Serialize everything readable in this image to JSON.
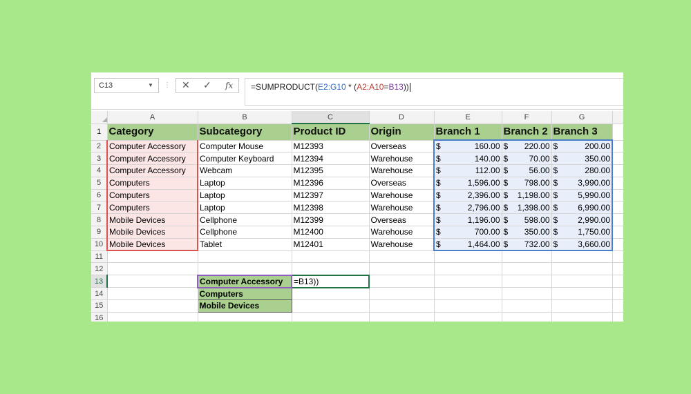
{
  "namebox": {
    "value": "C13"
  },
  "formula_bar": {
    "prefix": "=SUMPRODUCT(",
    "range1": "E2:G10",
    "mid": " * (",
    "range2": "A2:A10",
    "eq": "=",
    "range3": "B13",
    "suffix": "))"
  },
  "icons": {
    "cancel": "✕",
    "enter": "✓",
    "fx": "fx"
  },
  "columns": [
    "A",
    "B",
    "C",
    "D",
    "E",
    "F",
    "G"
  ],
  "headers": [
    "Category",
    "Subcategory",
    "Product ID",
    "Origin",
    "Branch 1",
    "Branch 2",
    "Branch 3"
  ],
  "currency": "$",
  "rows": [
    {
      "n": "2",
      "cat": "Computer Accessory",
      "sub": "Computer Mouse",
      "id": "M12393",
      "origin": "Overseas",
      "b1": "160.00",
      "b2": "220.00",
      "b3": "200.00"
    },
    {
      "n": "3",
      "cat": "Computer Accessory",
      "sub": "Computer Keyboard",
      "id": "M12394",
      "origin": "Warehouse",
      "b1": "140.00",
      "b2": "70.00",
      "b3": "350.00"
    },
    {
      "n": "4",
      "cat": "Computer Accessory",
      "sub": "Webcam",
      "id": "M12395",
      "origin": "Warehouse",
      "b1": "112.00",
      "b2": "56.00",
      "b3": "280.00"
    },
    {
      "n": "5",
      "cat": "Computers",
      "sub": "Laptop",
      "id": "M12396",
      "origin": "Overseas",
      "b1": "1,596.00",
      "b2": "798.00",
      "b3": "3,990.00"
    },
    {
      "n": "6",
      "cat": "Computers",
      "sub": "Laptop",
      "id": "M12397",
      "origin": "Warehouse",
      "b1": "2,396.00",
      "b2": "1,198.00",
      "b3": "5,990.00"
    },
    {
      "n": "7",
      "cat": "Computers",
      "sub": "Laptop",
      "id": "M12398",
      "origin": "Warehouse",
      "b1": "2,796.00",
      "b2": "1,398.00",
      "b3": "6,990.00"
    },
    {
      "n": "8",
      "cat": "Mobile Devices",
      "sub": "Cellphone",
      "id": "M12399",
      "origin": "Overseas",
      "b1": "1,196.00",
      "b2": "598.00",
      "b3": "2,990.00"
    },
    {
      "n": "9",
      "cat": "Mobile Devices",
      "sub": "Cellphone",
      "id": "M12400",
      "origin": "Warehouse",
      "b1": "700.00",
      "b2": "350.00",
      "b3": "1,750.00"
    },
    {
      "n": "10",
      "cat": "Mobile Devices",
      "sub": "Tablet",
      "id": "M12401",
      "origin": "Warehouse",
      "b1": "1,464.00",
      "b2": "732.00",
      "b3": "3,660.00"
    }
  ],
  "row_numbers": {
    "r1": "1",
    "r11": "11",
    "r12": "12",
    "r13": "13",
    "r14": "14",
    "r15": "15",
    "r16": "16"
  },
  "lookup": {
    "b13": "Computer Accessory",
    "b14": "Computers",
    "b15": "Mobile Devices",
    "c13_edit": "=B13))"
  }
}
